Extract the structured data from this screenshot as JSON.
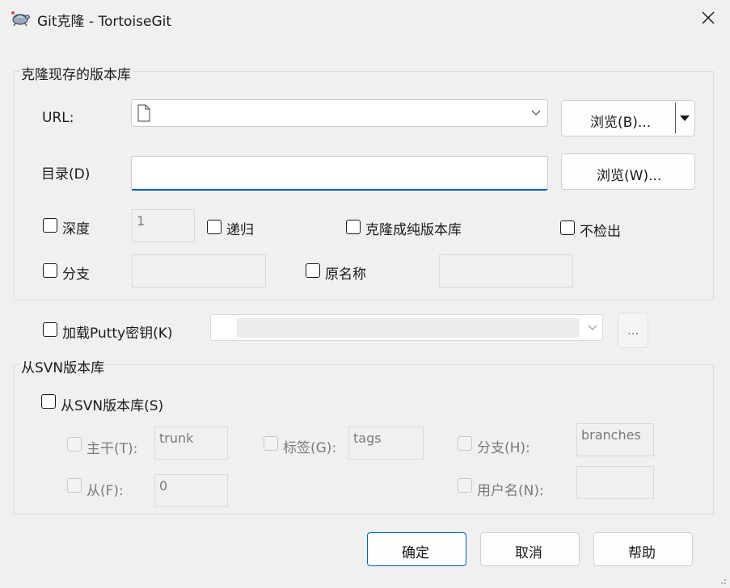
{
  "window": {
    "title": "Git克隆 - TortoiseGit"
  },
  "icons": {
    "app": "tortoise-icon",
    "close": "close-icon",
    "file": "file-icon",
    "chevron": "chevron-down-icon"
  },
  "colors": {
    "accent": "#005fb8",
    "background": "#f0f0f0"
  },
  "clone_group": {
    "title": "克隆现存的版本库",
    "url_label": "URL:",
    "url_value": "",
    "browse_b": "浏览(B)...",
    "dir_label": "目录(D)",
    "dir_value": "",
    "browse_w": "浏览(W)...",
    "depth_label": "深度",
    "depth_value": "1",
    "recursive_label": "递归",
    "bare_label": "克隆成纯版本库",
    "no_checkout_label": "不检出",
    "branch_label": "分支",
    "branch_value": "",
    "origin_label": "原名称",
    "origin_value": ""
  },
  "putty": {
    "label": "加载Putty密钥(K)",
    "value": "",
    "browse": "..."
  },
  "svn_group": {
    "title": "从SVN版本库",
    "from_svn_label": "从SVN版本库(S)",
    "trunk_label": "主干(T):",
    "trunk_value": "trunk",
    "tags_label": "标签(G):",
    "tags_value": "tags",
    "branches_label": "分支(H):",
    "branches_value": "branches",
    "from_label": "从(F):",
    "from_value": "0",
    "username_label": "用户名(N):",
    "username_value": ""
  },
  "buttons": {
    "ok": "确定",
    "cancel": "取消",
    "help": "帮助"
  }
}
